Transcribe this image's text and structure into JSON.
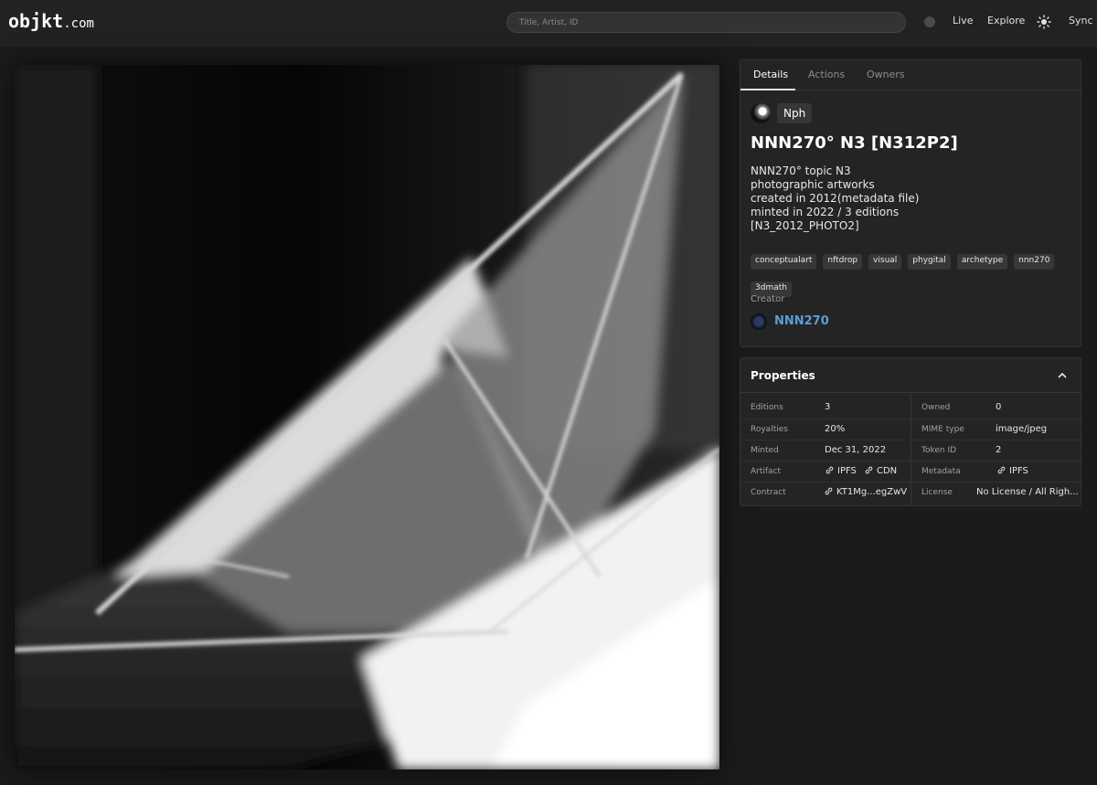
{
  "header": {
    "logo_main": "objkt",
    "logo_suffix": ".com",
    "search_placeholder": "Title, Artist, ID",
    "nav": {
      "live": "Live",
      "explore": "Explore",
      "sync": "Sync"
    }
  },
  "details": {
    "tabs": [
      "Details",
      "Actions",
      "Owners"
    ],
    "owner": "Nph",
    "title": "NNN270° N3 [N312P2]",
    "description": [
      "NNN270° topic N3",
      "photographic artworks",
      "created in 2012(metadata file)",
      "minted in 2022 / 3 editions",
      "[N3_2012_PHOTO2]"
    ],
    "tags": [
      "conceptualart",
      "nftdrop",
      "visual",
      "phygital",
      "archetype",
      "nnn270",
      "3dmath"
    ],
    "creator_label": "Creator",
    "creator_name": "NNN270"
  },
  "properties": {
    "title": "Properties",
    "editions_label": "Editions",
    "editions": "3",
    "owned_label": "Owned",
    "owned": "0",
    "royalties_label": "Royalties",
    "royalties": "20%",
    "mime_label": "MIME type",
    "mime": "image/jpeg",
    "minted_label": "Minted",
    "minted": "Dec 31, 2022",
    "token_id_label": "Token ID",
    "token_id": "2",
    "artifact_label": "Artifact",
    "artifact_ipfs": "IPFS",
    "artifact_cdn": "CDN",
    "metadata_label": "Metadata",
    "metadata_ipfs": "IPFS",
    "contract_label": "Contract",
    "contract": "KT1Mg...egZwV",
    "license_label": "License",
    "license": "No License / All Righ..."
  },
  "colors": {
    "accent_link": "#5b9ed9",
    "background": "#1b1b1b",
    "panel": "#242424"
  }
}
